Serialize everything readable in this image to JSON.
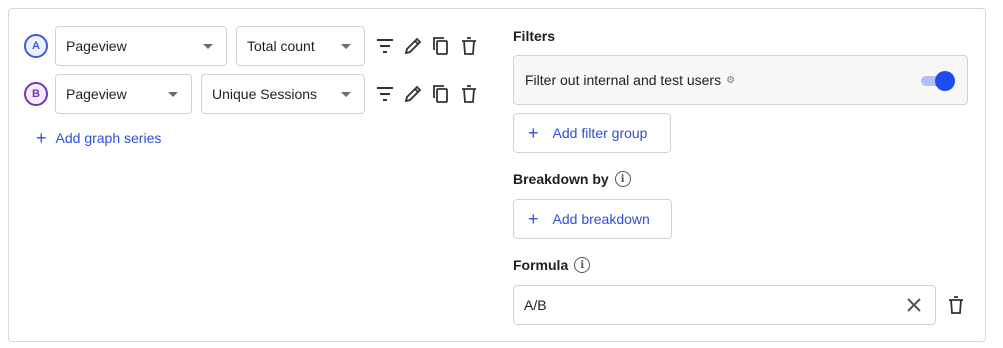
{
  "series": [
    {
      "letter": "A",
      "color": "#3b5bdb",
      "event": "Pageview",
      "math": "Total count"
    },
    {
      "letter": "B",
      "color": "#7b2fb8",
      "event": "Pageview",
      "math": "Unique Sessions"
    }
  ],
  "icons": [
    "filter-icon",
    "edit-icon",
    "duplicate-icon",
    "delete-icon"
  ],
  "add_series_label": "Add graph series",
  "filters": {
    "title": "Filters",
    "internal_label": "Filter out internal and test users",
    "internal_enabled": true,
    "add_filter_group_label": "Add filter group"
  },
  "breakdown": {
    "title": "Breakdown by",
    "add_label": "Add breakdown"
  },
  "formula": {
    "title": "Formula",
    "value": "A/B"
  },
  "colors": {
    "accent": "#2f4ed9",
    "toggle_on": "#1f4cf0"
  }
}
